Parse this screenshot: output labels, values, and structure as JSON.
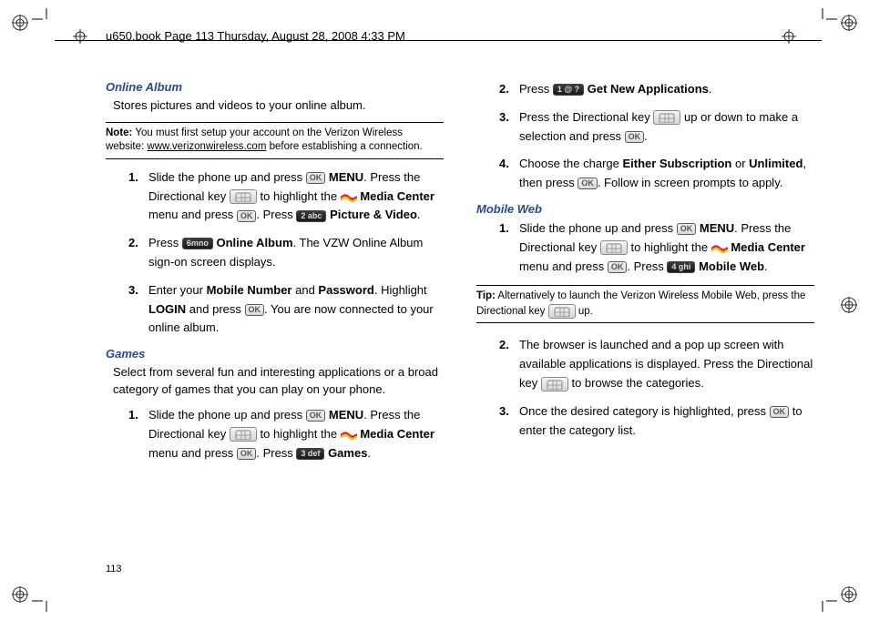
{
  "header": "u650.book  Page 113  Thursday, August 28, 2008  4:33 PM",
  "page_number": "113",
  "left": {
    "online_album": {
      "title": "Online Album",
      "intro": "Stores pictures and videos to your online album.",
      "note_label": "Note:",
      "note_t1": " You must first setup your account on the Verizon Wireless website: ",
      "note_link": "www.verizonwireless.com",
      "note_t2": " before establishing a connection.",
      "s1_a": "Slide the phone up and press ",
      "s1_menu": "MENU",
      "s1_b": ". Press the Directional key ",
      "s1_c": " to highlight the ",
      "s1_mc": "Media Center",
      "s1_d": " menu and press ",
      "s1_e": ".  Press ",
      "s1_pv": "Picture & Video",
      "s1_f": ".",
      "s2_a": "Press ",
      "s2_oa": "Online Album",
      "s2_b": ". The VZW Online Album sign-on screen displays.",
      "s3_a": "Enter your ",
      "s3_mn": "Mobile Number",
      "s3_and": " and ",
      "s3_pw": "Password",
      "s3_b": ". Highlight ",
      "s3_login": "LOGIN",
      "s3_c": " and press ",
      "s3_d": ". You are now connected to your online album."
    },
    "games": {
      "title": "Games",
      "intro": "Select from several fun and interesting applications or a broad category of games that you can play on your phone.",
      "s1_a": "Slide the phone up and press ",
      "s1_menu": "MENU",
      "s1_b": ". Press the Directional key ",
      "s1_c": " to highlight the ",
      "s1_mc": "Media Center",
      "s1_d": " menu and press ",
      "s1_e": ".  Press ",
      "s1_g": "Games",
      "s1_f": "."
    }
  },
  "right": {
    "gna": {
      "s2_a": "Press ",
      "s2_gna": "Get New Applications",
      "s2_b": ".",
      "s3_a": "Press the Directional key ",
      "s3_b": " up or down to make a selection and press ",
      "s3_c": ".",
      "s4_a": "Choose the charge ",
      "s4_es": "Either Subscription",
      "s4_or": " or ",
      "s4_ul": "Unlimited",
      "s4_b": ", then press ",
      "s4_c": ". Follow in screen prompts to apply."
    },
    "mweb": {
      "title": "Mobile Web",
      "s1_a": "Slide the phone up and press ",
      "s1_menu": "MENU",
      "s1_b": ". Press the Directional key ",
      "s1_c": " to highlight the ",
      "s1_mc": "Media Center",
      "s1_d": " menu and press ",
      "s1_e": ". Press ",
      "s1_mw": "Mobile Web",
      "s1_f": ".",
      "tip_label": "Tip:",
      "tip_a": " Alternatively to launch the Verizon Wireless Mobile Web, press the Directional key ",
      "tip_b": " up.",
      "s2_a": "The browser is launched and a pop up screen with available applications is displayed. Press the Directional key ",
      "s2_b": " to browse the categories.",
      "s3_a": "Once the desired category is highlighted, press ",
      "s3_b": " to enter the category list."
    }
  },
  "keys": {
    "ok": "OK",
    "k1": "1 @ ?",
    "k2": "2 abc",
    "k3": "3 def",
    "k4": "4 ghi",
    "k6": "6mno"
  }
}
